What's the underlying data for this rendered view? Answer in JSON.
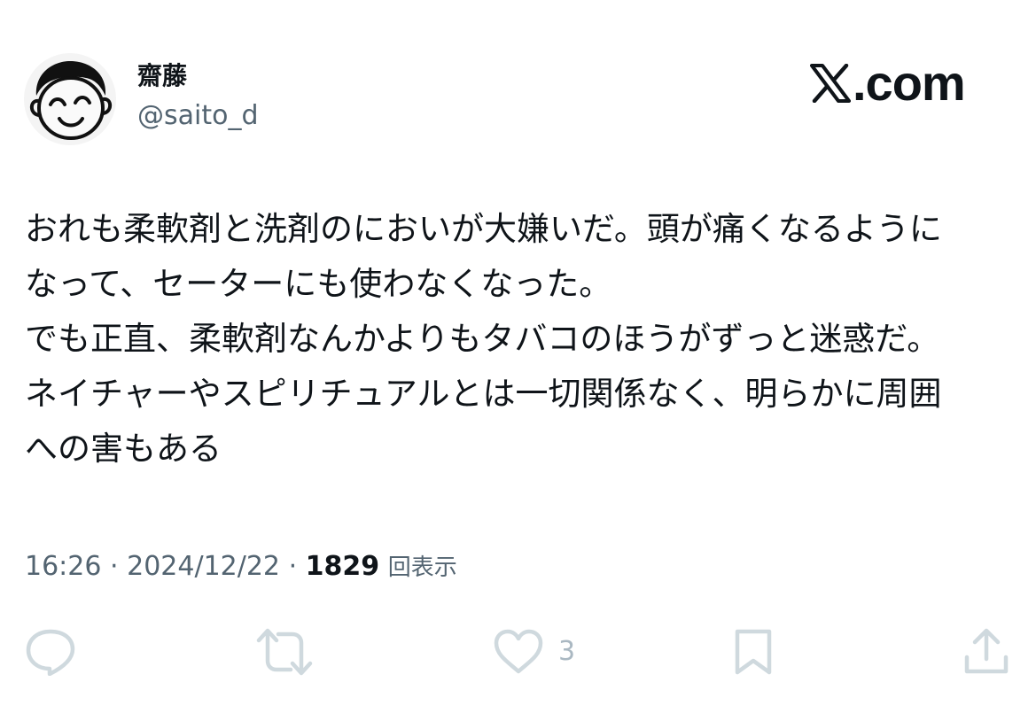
{
  "user": {
    "display_name": "齋藤",
    "handle": "@saito_d",
    "avatar_icon": "smiling-face-drawing"
  },
  "brand": {
    "logo_icon": "x-logo-icon",
    "suffix": ".com"
  },
  "post": {
    "lines": [
      "おれも柔軟剤と洗剤のにおいが大嫌いだ。頭が痛くなるように",
      "なって、セーターにも使わなくなった。",
      "でも正直、柔軟剤なんかよりもタバコのほうがずっと迷惑だ。",
      "ネイチャーやスピリチュアルとは一切関係なく、明らかに周囲",
      "への害もある"
    ]
  },
  "meta": {
    "time": "16:26",
    "separator": "·",
    "date": "2024/12/22",
    "views_count": "1829",
    "views_label": "回表示"
  },
  "actions": {
    "reply_icon": "reply-icon",
    "repost_icon": "repost-icon",
    "like_icon": "heart-icon",
    "like_count": "3",
    "bookmark_icon": "bookmark-icon",
    "share_icon": "share-icon"
  },
  "colors": {
    "text": "#0f1419",
    "secondary": "#536471",
    "icon": "#cfd9de"
  }
}
